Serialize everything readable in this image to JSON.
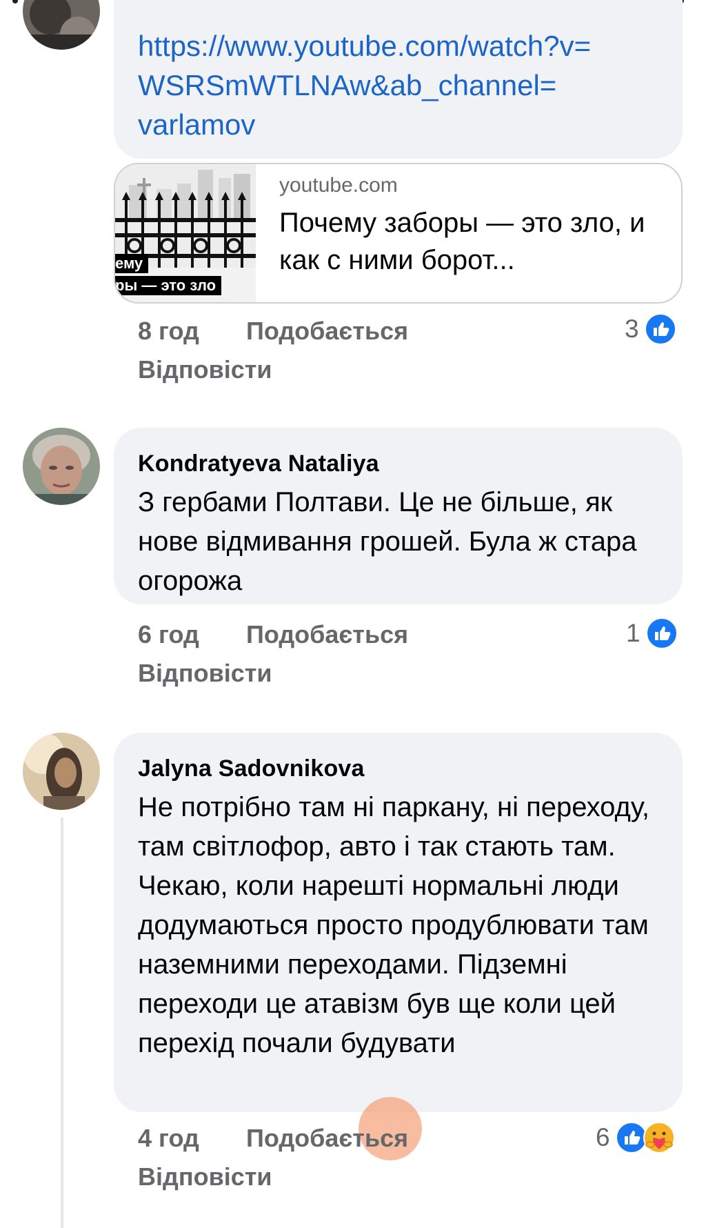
{
  "comment1": {
    "link_text": "https://www.youtube.com/watch?v=WSRSmWTLNAw&ab_channel=varlamov",
    "link_lines": [
      "https://www.youtube.com/watch?v=",
      "WSRSmWTLNAw&ab_channel=",
      "varlamov"
    ],
    "preview": {
      "domain": "youtube.com",
      "title": "Почему заборы — это зло, и как с ними борот...",
      "thumb_caption_line1": "ему",
      "thumb_caption_line2": "ры — это зло"
    },
    "time": "8 год",
    "like_label": "Подобається",
    "reply_label": "Відповісти",
    "reaction_count": "3",
    "reactions": [
      "like-icon"
    ]
  },
  "comment2": {
    "author": "Kondratyeva Nataliya",
    "text": "З гербами Полтави. Це не більше, як нове відмивання грошей. Була ж стара огорожа",
    "time": "6 год",
    "like_label": "Подобається",
    "reply_label": "Відповісти",
    "reaction_count": "1",
    "reactions": [
      "like-icon"
    ]
  },
  "comment3": {
    "author": "Jalyna  Sadovnikova",
    "text": "Не потрібно там ні паркану, ні переходу, там світлофор, авто і так стають там. Чекаю, коли нарешті нормальні люди додумаються просто продублювати там наземними переходами. Підземні переходи це атавізм був ще коли цей перехід почали будувати",
    "time": "4 год",
    "like_label": "Подобається",
    "reply_label": "Відповісти",
    "reaction_count": "6",
    "reactions": [
      "like-icon",
      "care-icon"
    ]
  },
  "colors": {
    "bubble_bg": "#f0f2f5",
    "link": "#1b65c8",
    "meta_text": "#65676b",
    "like_blue": "#1877f2"
  }
}
